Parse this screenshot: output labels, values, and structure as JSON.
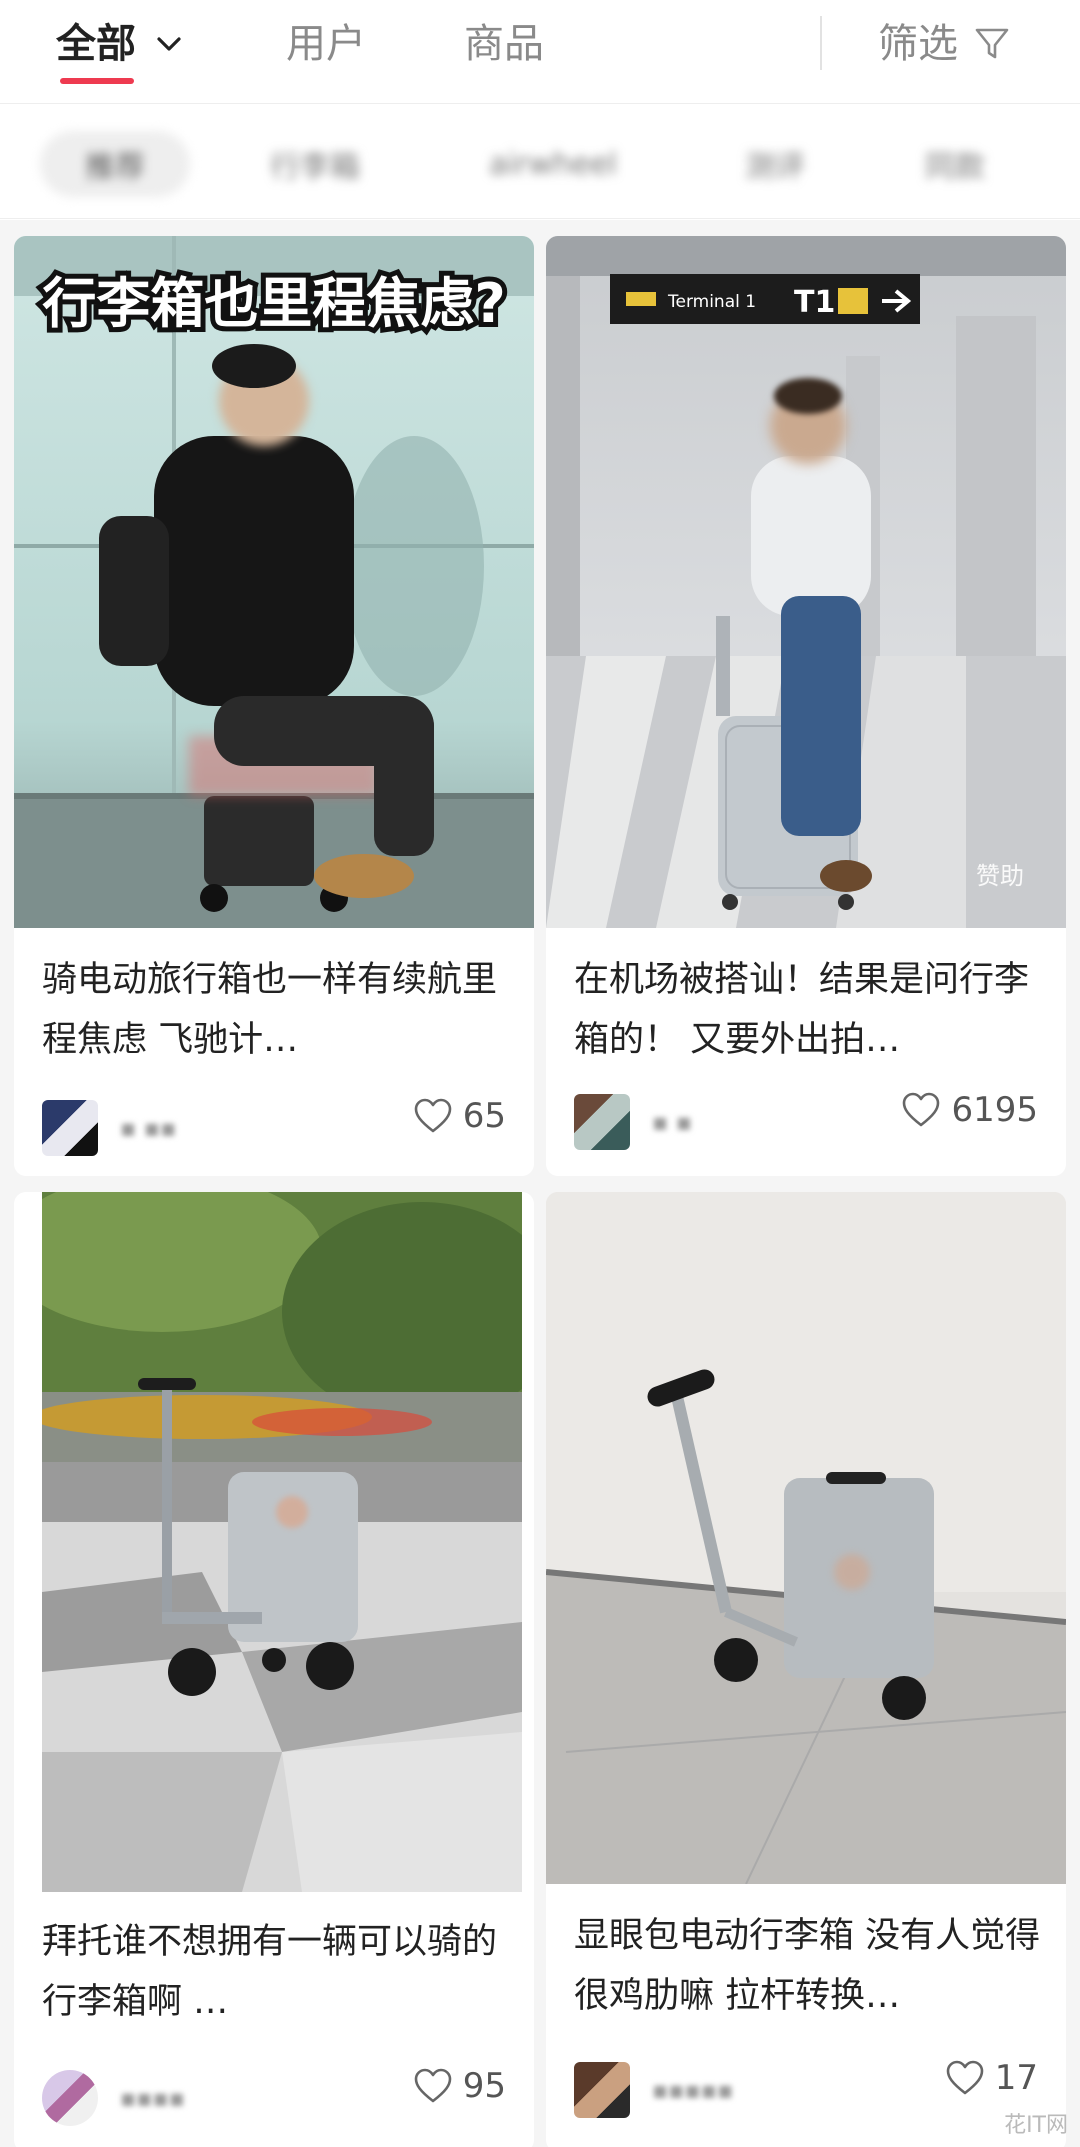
{
  "tabs": {
    "all": "全部",
    "user": "用户",
    "goods": "商品",
    "filter": "筛选"
  },
  "chips": [
    "推荐",
    "行李箱",
    "airwheel",
    "测评",
    "同款"
  ],
  "cards": [
    {
      "overlay_text": "行李箱也里程焦虑?",
      "title": "骑电动旅行箱也一样有续航里程焦虑 飞驰计…",
      "likes": "65",
      "sponsored": ""
    },
    {
      "overlay_text": "Terminal 1 T1",
      "title": "在机场被搭讪！结果是问行李箱的！ 又要外出拍…",
      "likes": "6195",
      "sponsored": "赞助"
    },
    {
      "overlay_text": "",
      "title": "拜托谁不想拥有一辆可以骑的行李箱啊 …",
      "likes": "95",
      "sponsored": ""
    },
    {
      "overlay_text": "",
      "title": "显眼包电动行李箱 没有人觉得很鸡肋嘛 拉杆转换…",
      "likes": "17",
      "sponsored": ""
    }
  ],
  "watermark": "花IT网",
  "colors": {
    "accent": "#ee3a50",
    "text": "#222222",
    "muted": "#8a8a8a",
    "feed_bg": "#f5f5f5"
  }
}
